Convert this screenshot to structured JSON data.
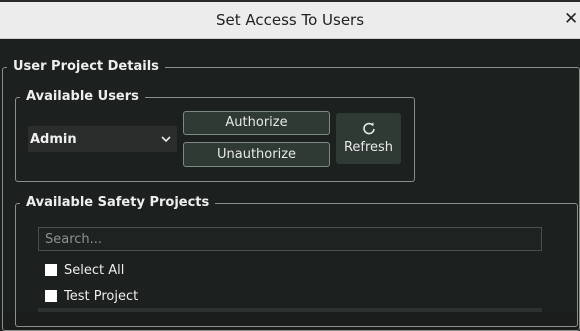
{
  "window": {
    "title": "Set Access To Users",
    "close_glyph": "✕"
  },
  "user_project_details": {
    "legend": "User Project Details"
  },
  "available_users": {
    "legend": "Available Users",
    "selected_user": "Admin",
    "authorize_label": "Authorize",
    "unauthorize_label": "Unauthorize",
    "refresh_label": "Refresh",
    "refresh_icon": "refresh-icon"
  },
  "available_safety_projects": {
    "legend": "Available Safety Projects",
    "search_placeholder": "Search...",
    "items": [
      {
        "label": "Select All",
        "checked": false
      },
      {
        "label": "Test Project",
        "checked": false
      }
    ]
  },
  "colors": {
    "background": "#1c201e",
    "titlebar": "#ececec",
    "button": "#2f3a34",
    "border": "#8a8f8c"
  }
}
